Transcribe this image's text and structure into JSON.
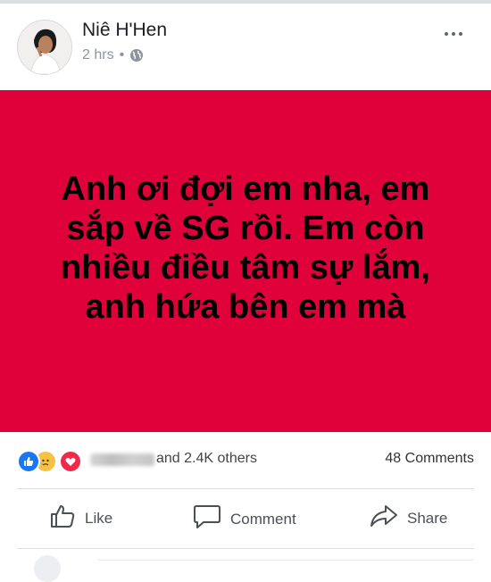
{
  "post": {
    "author": "Niê H'Hen",
    "time": "2 hrs",
    "privacy_separator": "•",
    "banner_lines": [
      "Anh ơi đợi em nha, em",
      "sắp về SG rồi. Em còn",
      "nhiều điều tâm sự lắm,",
      "anh hứa bên em mà"
    ],
    "banner_color": "#e0003a"
  },
  "reactions": {
    "others_text": "and 2.4K others",
    "comments_text": "48 Comments",
    "icons": [
      "like-reaction-icon",
      "sad-reaction-icon",
      "love-reaction-icon"
    ]
  },
  "actions": {
    "like": "Like",
    "comment": "Comment",
    "share": "Share"
  }
}
